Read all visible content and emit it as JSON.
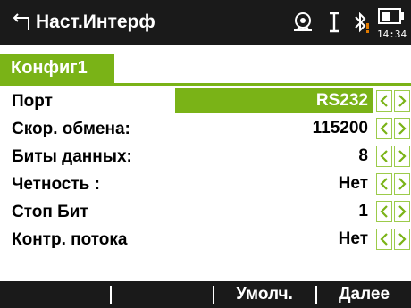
{
  "header": {
    "title": "Наст.Интерф",
    "clock": "14:34",
    "icons": [
      "back-arrow-icon",
      "gps-icon",
      "cursor-icon",
      "bluetooth-icon",
      "battery-icon"
    ]
  },
  "tabs": [
    {
      "label": "Конфиг1",
      "active": true
    }
  ],
  "rows": [
    {
      "label": "Порт",
      "value": "RS232",
      "selected": true
    },
    {
      "label": "Скор. обмена:",
      "value": "115200",
      "selected": false
    },
    {
      "label": "Биты данных:",
      "value": "8",
      "selected": false
    },
    {
      "label": "Четность :",
      "value": "Нет",
      "selected": false
    },
    {
      "label": "Стоп Бит",
      "value": "1",
      "selected": false
    },
    {
      "label": "Контр. потока",
      "value": "Нет",
      "selected": false
    }
  ],
  "softkeys": [
    "",
    "",
    "Умолч.",
    "Далее"
  ],
  "colors": {
    "accent": "#7ab317",
    "titlebar": "#1a1a1a",
    "warning": "#e07a00"
  }
}
